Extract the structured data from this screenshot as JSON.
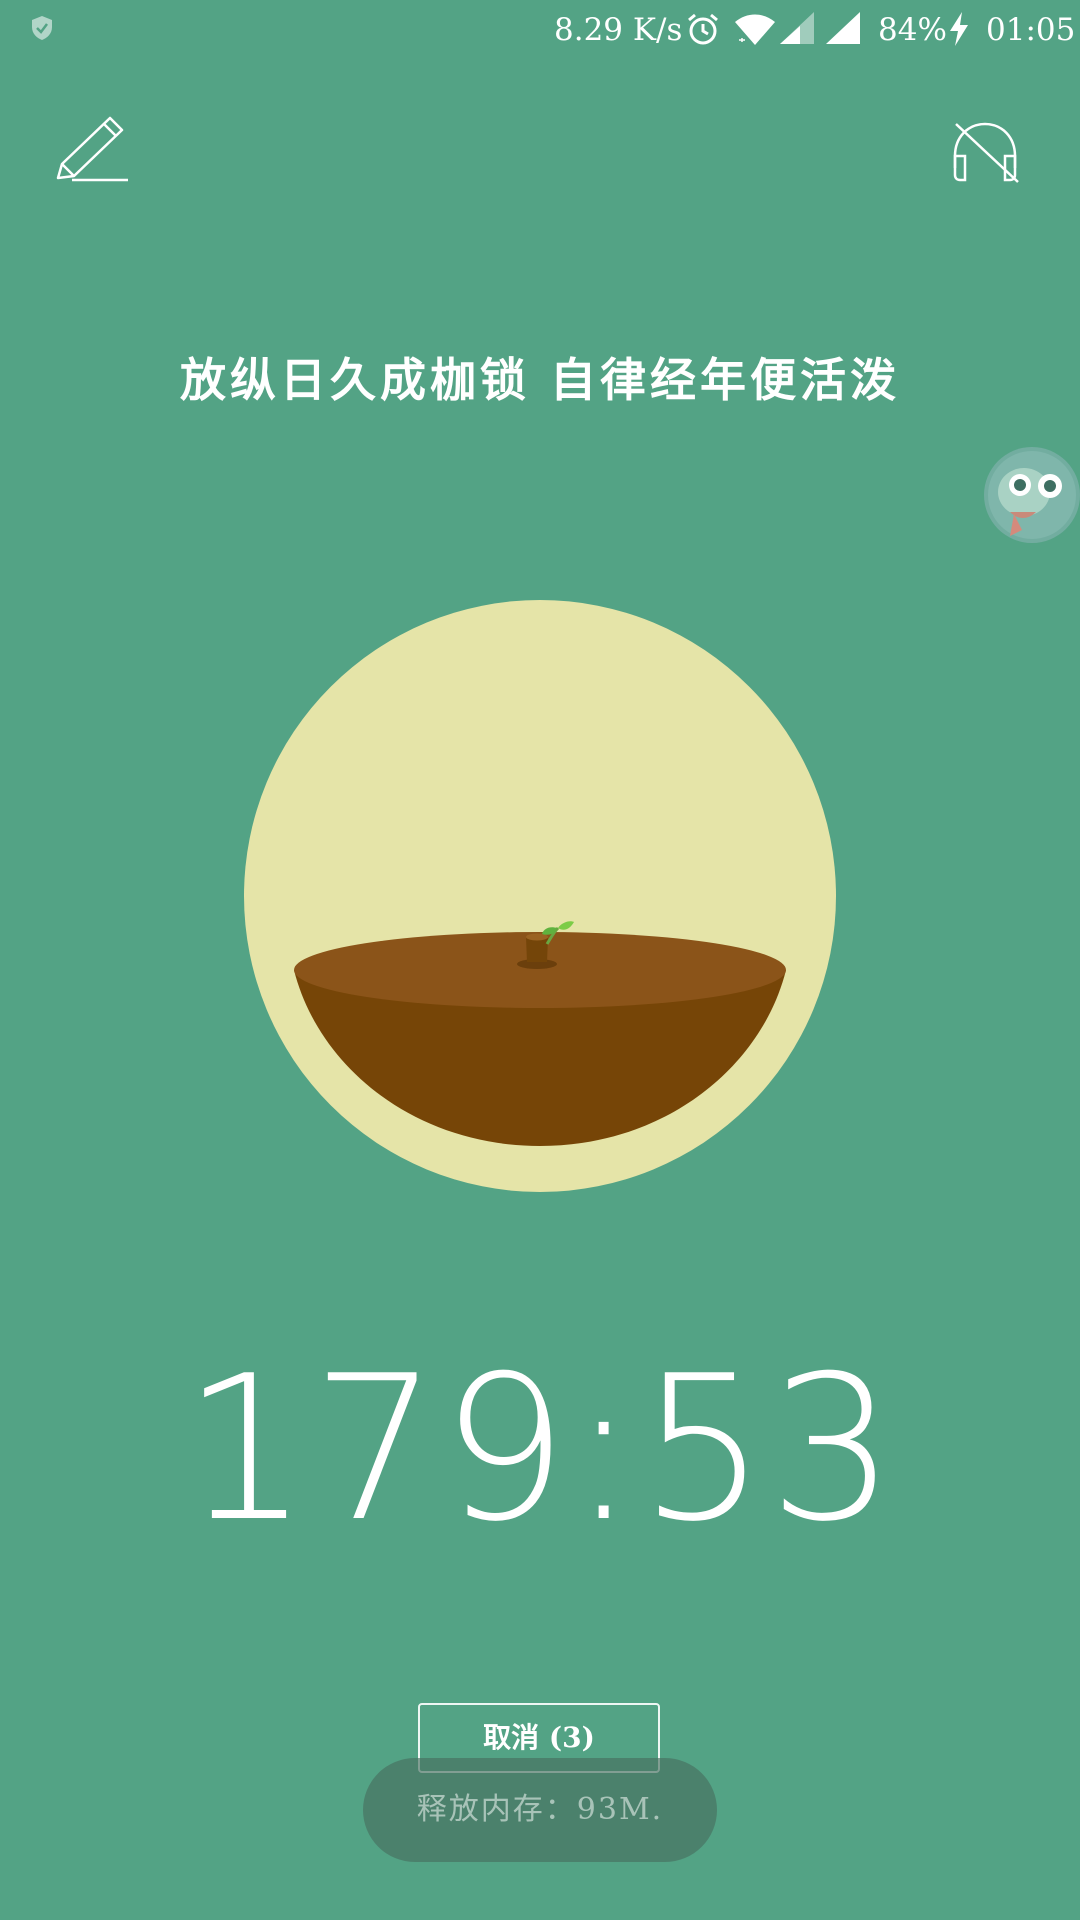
{
  "status_bar": {
    "net_speed": "8.29 K/s",
    "battery": "84%",
    "time": "01:05",
    "icons": [
      "shield-icon",
      "alarm-icon",
      "wifi-icon",
      "cell-signal-icon",
      "charging-icon"
    ]
  },
  "header": {
    "left_icon": "pencil-icon",
    "right_icon": "headphones-off-icon"
  },
  "motto": "放纵日久成枷锁 自律经年便活泼",
  "timer": "179:53",
  "cancel_label": "取消 (3)",
  "toast": "释放内存：93M.",
  "colors": {
    "background": "#53a385",
    "circle": "#e5e4a8",
    "soil_top": "#8b5419",
    "soil_body": "#764507",
    "sprout": "#5fb23e"
  }
}
